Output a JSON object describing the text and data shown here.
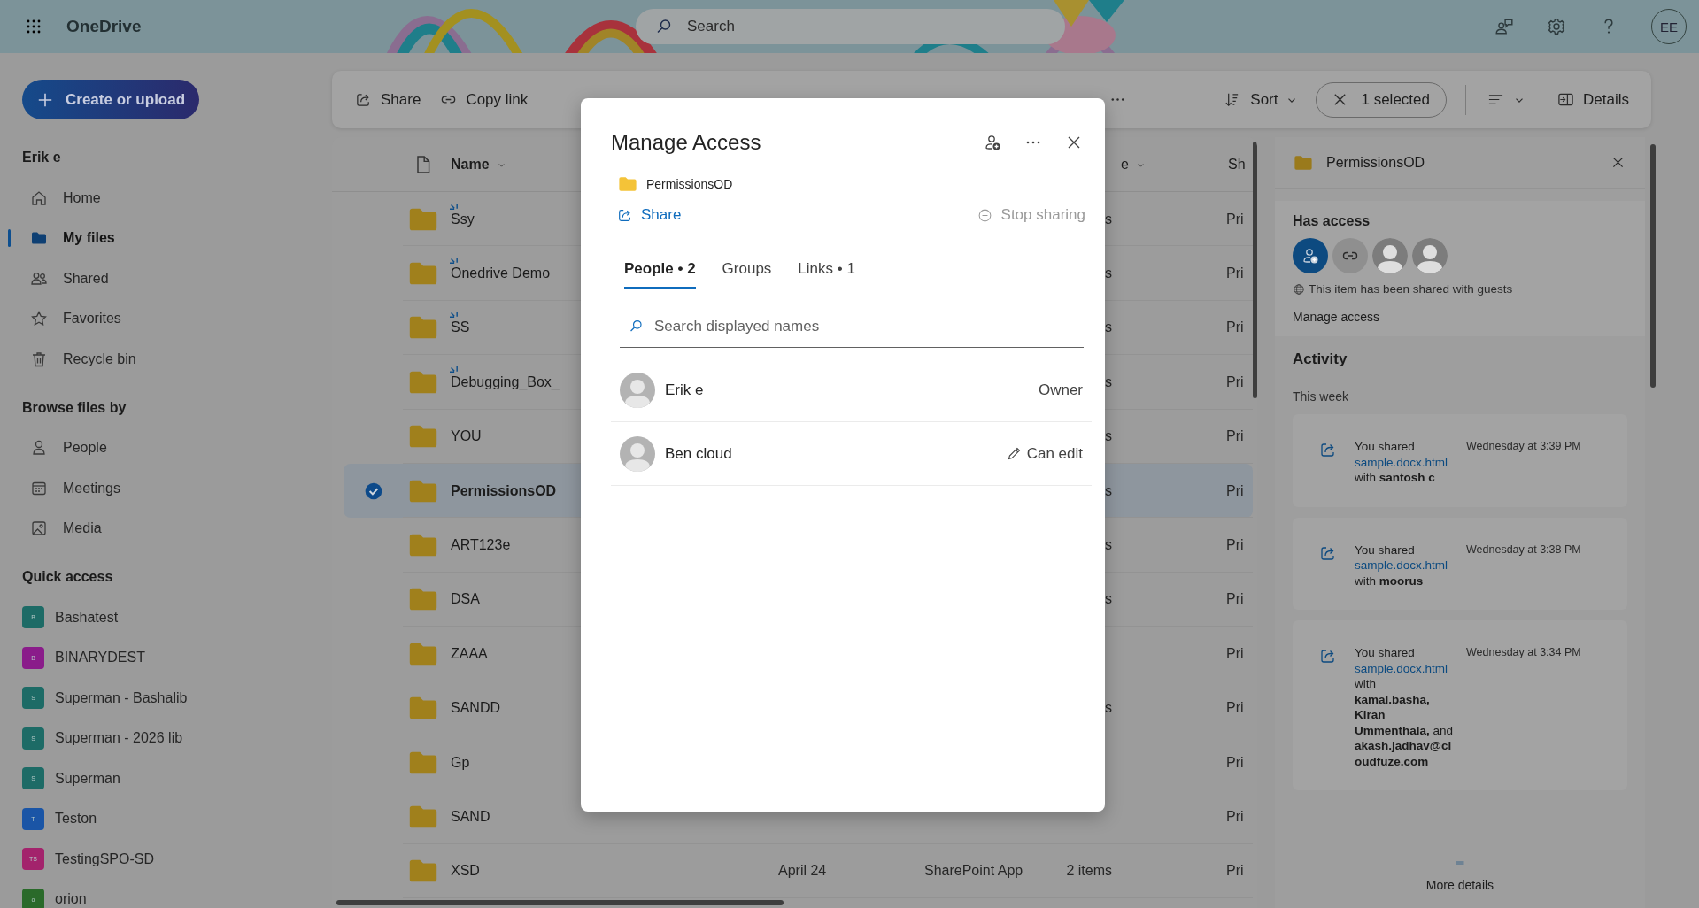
{
  "app": {
    "title": "OneDrive"
  },
  "search": {
    "placeholder": "Search"
  },
  "account": {
    "initials": "EE"
  },
  "nav": {
    "create_button": "Create or upload",
    "user": "Erik e",
    "items": [
      {
        "label": "Home",
        "selected": false
      },
      {
        "label": "My files",
        "selected": true
      },
      {
        "label": "Shared",
        "selected": false
      },
      {
        "label": "Favorites",
        "selected": false
      },
      {
        "label": "Recycle bin",
        "selected": false
      }
    ],
    "browse_heading": "Browse files by",
    "browse_items": [
      {
        "label": "People",
        "selected": false
      },
      {
        "label": "Meetings",
        "selected": false
      },
      {
        "label": "Media",
        "selected": false
      }
    ],
    "quick_heading": "Quick access",
    "quick_items": [
      {
        "label": "Bashatest",
        "badge": "B",
        "color": "#1d6b66"
      },
      {
        "label": "BINARYDEST",
        "badge": "B",
        "color": "#8a1c8a"
      },
      {
        "label": "Superman - Bashalib",
        "badge": "S",
        "color": "#1d6b66"
      },
      {
        "label": "Superman - 2026 lib",
        "badge": "S",
        "color": "#1d6b66"
      },
      {
        "label": "Superman",
        "badge": "S",
        "color": "#1d6b66"
      },
      {
        "label": "Teston",
        "badge": "T",
        "color": "#1a55a6"
      },
      {
        "label": "TestingSPO-SD",
        "badge": "TS",
        "color": "#a3236c"
      },
      {
        "label": "orion",
        "badge": "o",
        "color": "#2a6a2a"
      }
    ]
  },
  "toolbar": {
    "actions": [
      {
        "label": "Share"
      },
      {
        "label": "Copy link"
      }
    ],
    "sort": "Sort",
    "selection": "1 selected",
    "details": "Details"
  },
  "table": {
    "columns": [
      {
        "label": "Name",
        "kind": "name"
      },
      {
        "label": "e",
        "kind": "size"
      },
      {
        "label": "Sh",
        "kind": "sharing"
      }
    ],
    "rows": [
      {
        "name": "Ssy",
        "new": true,
        "selected": false,
        "size": "s",
        "sharing": "Pri"
      },
      {
        "name": "Onedrive Demo",
        "new": true,
        "selected": false,
        "size": "s",
        "sharing": "Pri"
      },
      {
        "name": "SS",
        "new": true,
        "selected": false,
        "size": "s",
        "sharing": "Pri"
      },
      {
        "name": "Debugging_Box_",
        "new": true,
        "selected": false,
        "size": "s",
        "sharing": "Pri"
      },
      {
        "name": "YOU",
        "new": false,
        "selected": false,
        "size": "s",
        "sharing": "Pri"
      },
      {
        "name": "PermissionsOD",
        "new": false,
        "selected": true,
        "size": "s",
        "sharing": "Pri"
      },
      {
        "name": "ART123e",
        "new": false,
        "selected": false,
        "size": "s",
        "sharing": "Pri"
      },
      {
        "name": "DSA",
        "new": false,
        "selected": false,
        "size": "s",
        "sharing": "Pri"
      },
      {
        "name": "ZAAA",
        "new": false,
        "selected": false,
        "sharing": "Pri"
      },
      {
        "name": "SANDD",
        "new": false,
        "selected": false,
        "size": "s",
        "sharing": "Pri"
      },
      {
        "name": "Gp",
        "new": false,
        "selected": false,
        "sharing": "Pri"
      },
      {
        "name": "SAND",
        "new": false,
        "selected": false,
        "sharing": "Pri"
      },
      {
        "name": "XSD",
        "new": false,
        "selected": false,
        "modified": "April 24",
        "modified_by": "SharePoint App",
        "size": "2 items",
        "sharing": "Pri"
      }
    ]
  },
  "details": {
    "title": "PermissionsOD",
    "has_access_heading": "Has access",
    "access": [
      {
        "kind": "add"
      },
      {
        "kind": "link"
      },
      {
        "kind": "person"
      },
      {
        "kind": "person"
      }
    ],
    "guests_note": "This item has been shared with guests",
    "manage_access": "Manage access",
    "activity_heading": "Activity",
    "period": "This week",
    "activities": [
      {
        "action": "You shared",
        "file": "sample.docx.html",
        "text": "with **santosh c**",
        "time": "Wednesday at 3:39 PM"
      },
      {
        "action": "You shared",
        "file": "sample.docx.html",
        "text": "with **moorus**",
        "time": "Wednesday at 3:38 PM"
      },
      {
        "action": "You shared",
        "file": "sample.docx.html",
        "text": "with **kamal.basha, Kiran Ummenthala,** and **akash.jadhav@cloudfuze.com**",
        "time": "Wednesday at 3:34 PM"
      }
    ],
    "more_details": "More details"
  },
  "dialog": {
    "title": "Manage Access",
    "item": "PermissionsOD",
    "share": "Share",
    "stop_sharing": "Stop sharing",
    "tabs": [
      {
        "label": "People • 2",
        "selected": true
      },
      {
        "label": "Groups",
        "selected": false
      },
      {
        "label": "Links • 1",
        "selected": false
      }
    ],
    "search_placeholder": "Search displayed names",
    "people": [
      {
        "name": "Erik e",
        "role": "Owner",
        "kind": "owner"
      },
      {
        "name": "Ben cloud",
        "role": "Can edit",
        "kind": "edit"
      }
    ]
  }
}
